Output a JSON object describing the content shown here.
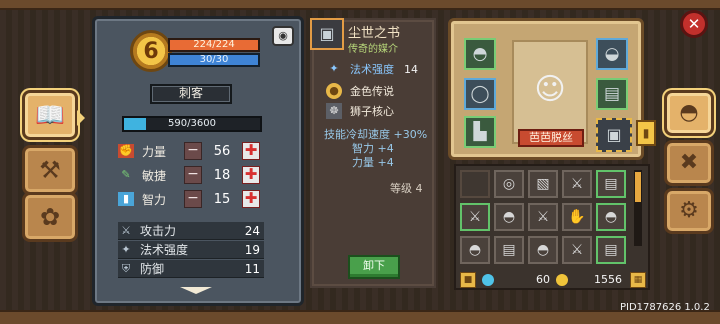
{
  "stats": {
    "level": "6",
    "hp": "224/224",
    "mp": "30/30",
    "class_name": "刺客",
    "exp_text": "590/3600",
    "exp_fraction": 0.164,
    "attributes": [
      {
        "label": "力量",
        "value": "56",
        "icon": "fist-icon"
      },
      {
        "label": "敏捷",
        "value": "18",
        "icon": "feather-icon"
      },
      {
        "label": "智力",
        "value": "15",
        "icon": "book-icon"
      }
    ],
    "substats": [
      {
        "label": "攻击力",
        "value": "24",
        "icon": "sword-icon"
      },
      {
        "label": "法术强度",
        "value": "19",
        "icon": "wand-icon"
      },
      {
        "label": "防御",
        "value": "11",
        "icon": "shield-icon"
      }
    ]
  },
  "item": {
    "name": "尘世之书",
    "rarity": "传奇的媒介",
    "stat_label": "法术强度",
    "stat_value": "14",
    "set_name": "金色传说",
    "core": "狮子核心",
    "bonuses": [
      "技能冷却速度 +30%",
      "智力 +4",
      "力量 +4"
    ],
    "level_label": "等级",
    "level_value": "4",
    "unequip_label": "卸下"
  },
  "character": {
    "name": "芭芭脱丝"
  },
  "currency": {
    "gems": "60",
    "coins": "1556"
  },
  "footer": {
    "pid": "PID1787626 1.0.2"
  },
  "colors": {
    "hp": "#e86b35",
    "mp": "#3f84d6",
    "exp": "#3fb3e0",
    "equip_green": "#79cc75",
    "accent_gold": "#f3c547"
  }
}
